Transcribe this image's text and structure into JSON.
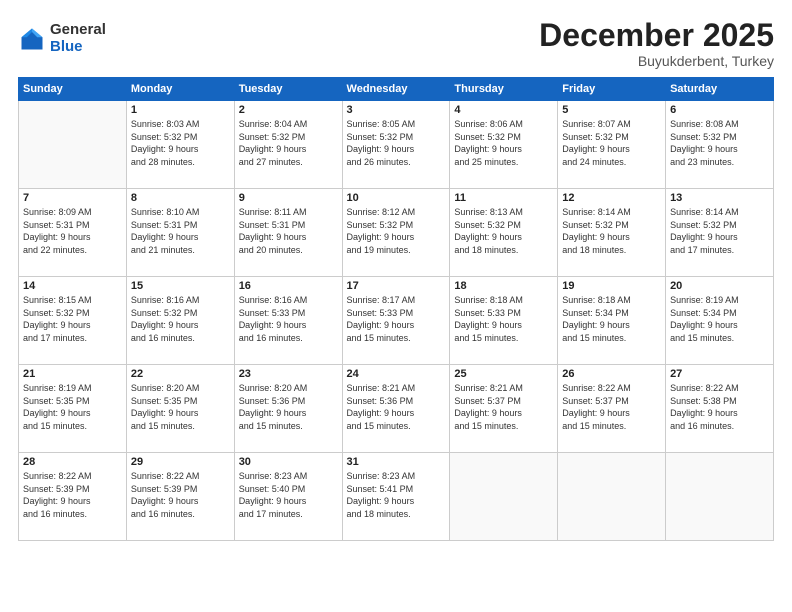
{
  "logo": {
    "general": "General",
    "blue": "Blue"
  },
  "header": {
    "month": "December 2025",
    "location": "Buyukderbent, Turkey"
  },
  "weekdays": [
    "Sunday",
    "Monday",
    "Tuesday",
    "Wednesday",
    "Thursday",
    "Friday",
    "Saturday"
  ],
  "weeks": [
    [
      {
        "day": "",
        "info": ""
      },
      {
        "day": "1",
        "info": "Sunrise: 8:03 AM\nSunset: 5:32 PM\nDaylight: 9 hours\nand 28 minutes."
      },
      {
        "day": "2",
        "info": "Sunrise: 8:04 AM\nSunset: 5:32 PM\nDaylight: 9 hours\nand 27 minutes."
      },
      {
        "day": "3",
        "info": "Sunrise: 8:05 AM\nSunset: 5:32 PM\nDaylight: 9 hours\nand 26 minutes."
      },
      {
        "day": "4",
        "info": "Sunrise: 8:06 AM\nSunset: 5:32 PM\nDaylight: 9 hours\nand 25 minutes."
      },
      {
        "day": "5",
        "info": "Sunrise: 8:07 AM\nSunset: 5:32 PM\nDaylight: 9 hours\nand 24 minutes."
      },
      {
        "day": "6",
        "info": "Sunrise: 8:08 AM\nSunset: 5:32 PM\nDaylight: 9 hours\nand 23 minutes."
      }
    ],
    [
      {
        "day": "7",
        "info": "Sunrise: 8:09 AM\nSunset: 5:31 PM\nDaylight: 9 hours\nand 22 minutes."
      },
      {
        "day": "8",
        "info": "Sunrise: 8:10 AM\nSunset: 5:31 PM\nDaylight: 9 hours\nand 21 minutes."
      },
      {
        "day": "9",
        "info": "Sunrise: 8:11 AM\nSunset: 5:31 PM\nDaylight: 9 hours\nand 20 minutes."
      },
      {
        "day": "10",
        "info": "Sunrise: 8:12 AM\nSunset: 5:32 PM\nDaylight: 9 hours\nand 19 minutes."
      },
      {
        "day": "11",
        "info": "Sunrise: 8:13 AM\nSunset: 5:32 PM\nDaylight: 9 hours\nand 18 minutes."
      },
      {
        "day": "12",
        "info": "Sunrise: 8:14 AM\nSunset: 5:32 PM\nDaylight: 9 hours\nand 18 minutes."
      },
      {
        "day": "13",
        "info": "Sunrise: 8:14 AM\nSunset: 5:32 PM\nDaylight: 9 hours\nand 17 minutes."
      }
    ],
    [
      {
        "day": "14",
        "info": "Sunrise: 8:15 AM\nSunset: 5:32 PM\nDaylight: 9 hours\nand 17 minutes."
      },
      {
        "day": "15",
        "info": "Sunrise: 8:16 AM\nSunset: 5:32 PM\nDaylight: 9 hours\nand 16 minutes."
      },
      {
        "day": "16",
        "info": "Sunrise: 8:16 AM\nSunset: 5:33 PM\nDaylight: 9 hours\nand 16 minutes."
      },
      {
        "day": "17",
        "info": "Sunrise: 8:17 AM\nSunset: 5:33 PM\nDaylight: 9 hours\nand 15 minutes."
      },
      {
        "day": "18",
        "info": "Sunrise: 8:18 AM\nSunset: 5:33 PM\nDaylight: 9 hours\nand 15 minutes."
      },
      {
        "day": "19",
        "info": "Sunrise: 8:18 AM\nSunset: 5:34 PM\nDaylight: 9 hours\nand 15 minutes."
      },
      {
        "day": "20",
        "info": "Sunrise: 8:19 AM\nSunset: 5:34 PM\nDaylight: 9 hours\nand 15 minutes."
      }
    ],
    [
      {
        "day": "21",
        "info": "Sunrise: 8:19 AM\nSunset: 5:35 PM\nDaylight: 9 hours\nand 15 minutes."
      },
      {
        "day": "22",
        "info": "Sunrise: 8:20 AM\nSunset: 5:35 PM\nDaylight: 9 hours\nand 15 minutes."
      },
      {
        "day": "23",
        "info": "Sunrise: 8:20 AM\nSunset: 5:36 PM\nDaylight: 9 hours\nand 15 minutes."
      },
      {
        "day": "24",
        "info": "Sunrise: 8:21 AM\nSunset: 5:36 PM\nDaylight: 9 hours\nand 15 minutes."
      },
      {
        "day": "25",
        "info": "Sunrise: 8:21 AM\nSunset: 5:37 PM\nDaylight: 9 hours\nand 15 minutes."
      },
      {
        "day": "26",
        "info": "Sunrise: 8:22 AM\nSunset: 5:37 PM\nDaylight: 9 hours\nand 15 minutes."
      },
      {
        "day": "27",
        "info": "Sunrise: 8:22 AM\nSunset: 5:38 PM\nDaylight: 9 hours\nand 16 minutes."
      }
    ],
    [
      {
        "day": "28",
        "info": "Sunrise: 8:22 AM\nSunset: 5:39 PM\nDaylight: 9 hours\nand 16 minutes."
      },
      {
        "day": "29",
        "info": "Sunrise: 8:22 AM\nSunset: 5:39 PM\nDaylight: 9 hours\nand 16 minutes."
      },
      {
        "day": "30",
        "info": "Sunrise: 8:23 AM\nSunset: 5:40 PM\nDaylight: 9 hours\nand 17 minutes."
      },
      {
        "day": "31",
        "info": "Sunrise: 8:23 AM\nSunset: 5:41 PM\nDaylight: 9 hours\nand 18 minutes."
      },
      {
        "day": "",
        "info": ""
      },
      {
        "day": "",
        "info": ""
      },
      {
        "day": "",
        "info": ""
      }
    ]
  ]
}
